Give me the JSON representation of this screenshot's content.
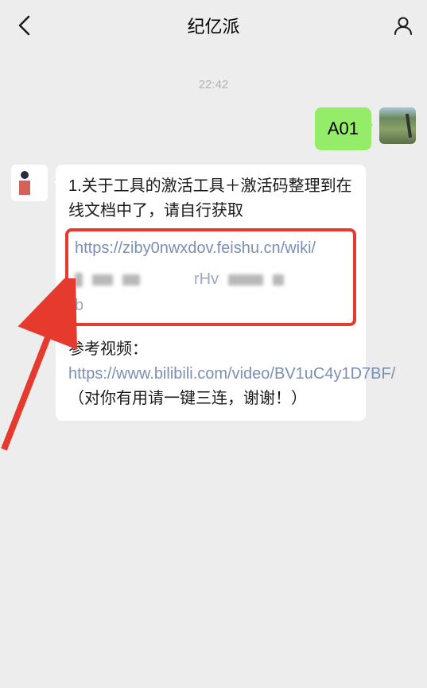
{
  "header": {
    "title": "纪亿派"
  },
  "timestamp": "22:42",
  "outgoing": {
    "text": "A01"
  },
  "incoming": {
    "line1": "1.关于工具的激活工具＋激活码整理到在线文档中了，请自行获取",
    "link1a": "https://ziby0nwxdov.feishu.cn/wiki/",
    "frag1": "rHv",
    "frag2": "b",
    "ref_label": "参考视频：",
    "link2": "https://www.bilibili.com/video/BV1uC4y1D7BF/",
    "tail": "（对你有用请一键三连，谢谢！）"
  }
}
